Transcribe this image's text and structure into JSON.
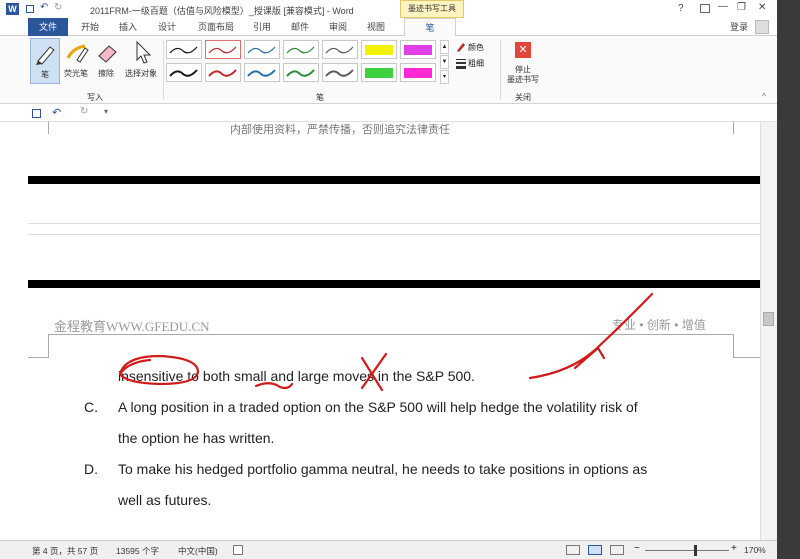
{
  "title": "2011FRM-一级百题（估值与风险模型）_授课版 [兼容模式] - Word",
  "context_tab": "墨迹书写工具",
  "window_controls": {
    "help": "?",
    "minimize": "—",
    "restore": "❐",
    "close": "✕"
  },
  "login": "登录",
  "tabs": [
    "文件",
    "开始",
    "插入",
    "设计",
    "页面布局",
    "引用",
    "邮件",
    "审阅",
    "视图",
    "笔"
  ],
  "ribbon": {
    "write_tools": [
      {
        "label": "笔",
        "icon": "pen-icon"
      },
      {
        "label": "荧光笔",
        "icon": "highlighter-icon"
      },
      {
        "label": "擦除",
        "icon": "eraser-icon"
      },
      {
        "label": "选择对象",
        "icon": "select-pointer-icon"
      }
    ],
    "group_write": "写入",
    "group_pens": "笔",
    "pen_colors": [
      "#1a1a1a",
      "#c0282d",
      "#2a6fa8",
      "#2f8a3a",
      "#5a5a5a",
      "#f2f200",
      "#e23ee8",
      "#1a1a1a",
      "#c0282d",
      "#2a6fa8",
      "#2f8a3a",
      "#5a5a5a",
      "#3dd13d",
      "#ff2ad4"
    ],
    "color_label": "颜色",
    "thickness_label": "粗细",
    "stop_label_1": "停止",
    "stop_label_2": "墨迹书写",
    "group_close": "关闭"
  },
  "document": {
    "top_faint": "内部使用资料，严禁传播，否则追究法律责任",
    "header_left": "金程教育WWW.GFEDU.CN",
    "header_right": "专业 • 创新 • 增值",
    "line1": "insensitive to both small and large moves in the S&P 500.",
    "option_c_letter": "C.",
    "option_c_line1": "A long position in a traded option on the S&P 500 will help hedge the volatility risk of",
    "option_c_line2": "the option he has written.",
    "option_d_letter": "D.",
    "option_d_line1": "To make his hedged portfolio gamma neutral, he needs to take positions in options as",
    "option_d_line2": "well as futures."
  },
  "status": {
    "page": "第 4 页，共 57 页",
    "words": "13595 个字",
    "language": "中文(中国)",
    "zoom": "170%"
  },
  "ink_color": "#d11a1a"
}
